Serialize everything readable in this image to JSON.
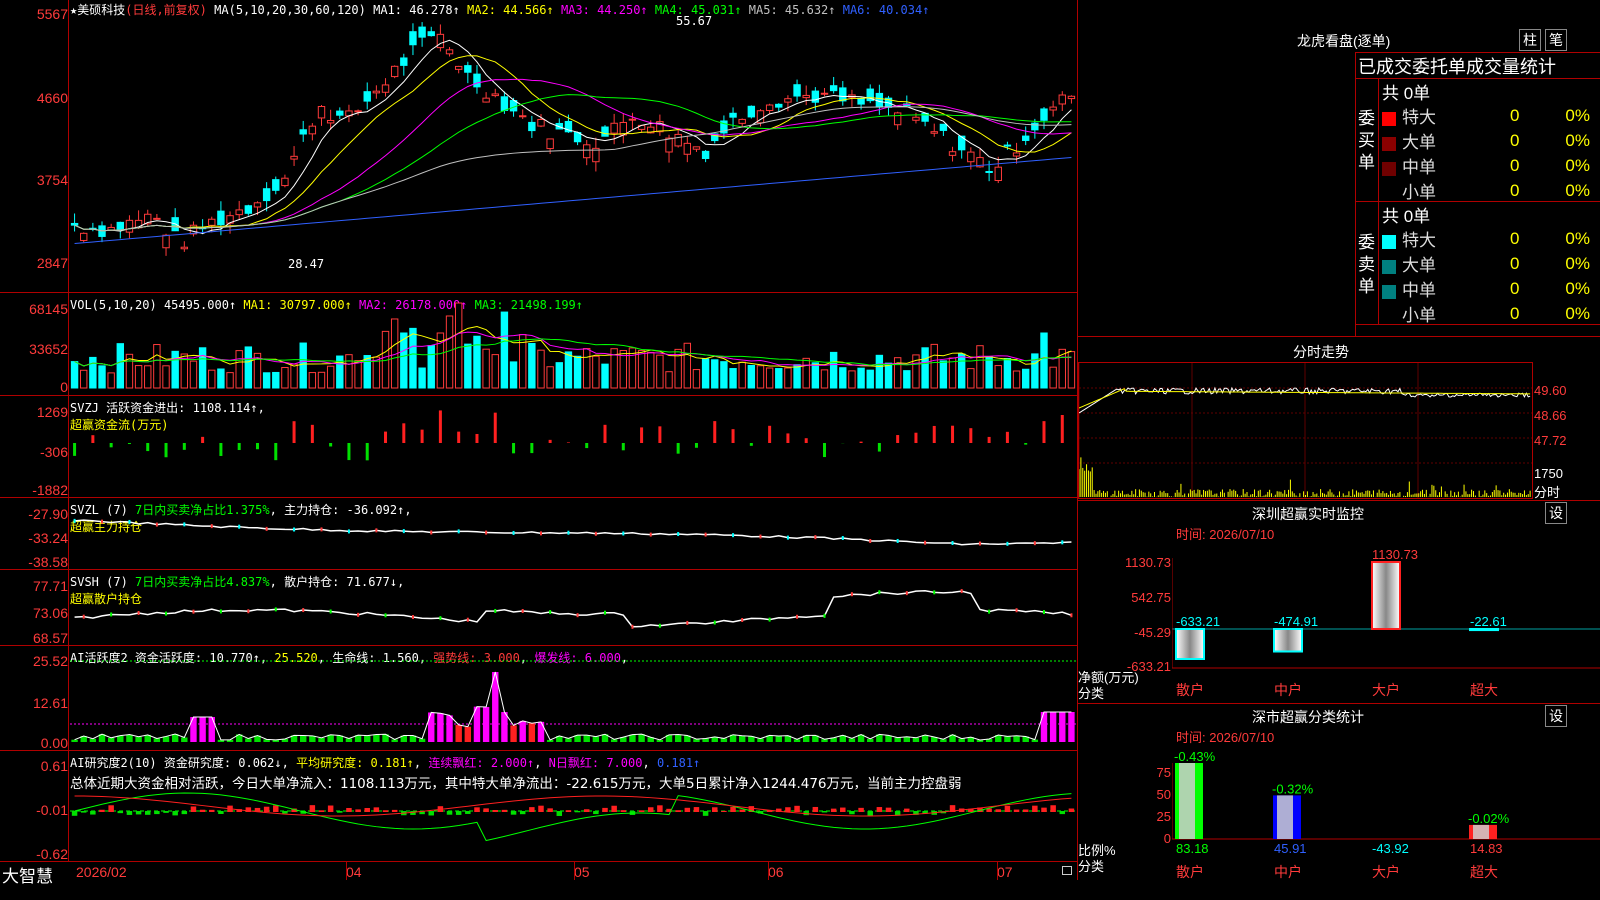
{
  "stock": {
    "name": "★美硕科技",
    "mode": "(日线,前复权)"
  },
  "price_panel": {
    "ma_label": "MA(5,10,20,30,60,120)",
    "ma": [
      {
        "label": "MA1: 46.278↑",
        "color": "#ffffff"
      },
      {
        "label": "MA2: 44.566↑",
        "color": "#ffff00"
      },
      {
        "label": "MA3: 44.250↑",
        "color": "#ff00ff"
      },
      {
        "label": "MA4: 45.031↑",
        "color": "#00ff00"
      },
      {
        "label": "MA5: 45.632↑",
        "color": "#c0c0c0"
      },
      {
        "label": "MA6: 40.034↑",
        "color": "#3060ff"
      }
    ],
    "axis": [
      "5567",
      "4660",
      "3754",
      "2847"
    ],
    "high_label": "55.67",
    "low_label": "28.47"
  },
  "vol_panel": {
    "label": "VOL(5,10,20)",
    "value": "45495.000↑",
    "ma1": "MA1: 30797.000↑",
    "ma2": "MA2: 26178.000↑",
    "ma3": "MA3: 21498.199↑",
    "axis": [
      "68145",
      "33652",
      "0"
    ]
  },
  "svzj_panel": {
    "label": "SVZJ",
    "title": "活跃资金进出: 1108.114↑",
    "sub": "超赢资金流(万元)",
    "axis": [
      "1269",
      "-306",
      "-1882"
    ]
  },
  "svzl_panel": {
    "label": "SVZL (7)",
    "ratio": "7日内买卖净占比1.375%",
    "hold": "主力持仓: -36.092↑",
    "sub": "超赢主力持仓",
    "axis": [
      "-27.90",
      "-33.24",
      "-38.58"
    ]
  },
  "svsh_panel": {
    "label": "SVSH (7)",
    "ratio": "7日内买卖净占比4.837%",
    "hold": "散户持仓: 71.677↓",
    "sub": "超赢散户持仓",
    "axis": [
      "77.71",
      "73.06",
      "68.57"
    ]
  },
  "ai_active": {
    "label": "AI活跃度2",
    "a": "资金活跃度: 10.770↑",
    "b": "25.520",
    "c": "生命线: 1.560",
    "d": "强势线: 3.000",
    "e": "爆发线: 6.000",
    "axis": [
      "25.52",
      "12.61",
      "0.00"
    ]
  },
  "ai_research": {
    "label": "AI研究度2(10)",
    "a": "资金研究度: 0.062↓",
    "b": "平均研究度: 0.181↑",
    "c": "连续飘红: 2.000↑",
    "d": "N日飘红: 7.000",
    "e": "0.181↑",
    "summary": "总体近期大资金相对活跃，今日大单净流入：1108.113万元，其中特大单净流出：-22.615万元，大单5日累计净入1244.476万元，当前主力控盘弱",
    "axis": [
      "0.61",
      "-0.01",
      "-0.62"
    ]
  },
  "date_axis": [
    "2026/02",
    "04",
    "05",
    "06",
    "07"
  ],
  "brand": "大智慧",
  "longhu": {
    "title": "龙虎看盘(逐单)",
    "btn_col": "柱",
    "btn_tick": "笔",
    "tabs": "已成交委托单成交量统计",
    "buy_label": "委买单",
    "sell_label": "委卖单",
    "buy_total": "共 0单",
    "sell_total": "共 0单",
    "buy_rows": [
      {
        "name": "特大",
        "count": "0",
        "pct": "0%",
        "color": "#ff0000"
      },
      {
        "name": "大单",
        "count": "0",
        "pct": "0%",
        "color": "#8b0000"
      },
      {
        "name": "中单",
        "count": "0",
        "pct": "0%",
        "color": "#700000"
      },
      {
        "name": "小单",
        "count": "0",
        "pct": "0%",
        "color": ""
      }
    ],
    "sell_rows": [
      {
        "name": "特大",
        "count": "0",
        "pct": "0%",
        "color": "#00ffff"
      },
      {
        "name": "大单",
        "count": "0",
        "pct": "0%",
        "color": "#008080"
      },
      {
        "name": "中单",
        "count": "0",
        "pct": "0%",
        "color": "#008080"
      },
      {
        "name": "小单",
        "count": "0",
        "pct": "0%",
        "color": ""
      }
    ]
  },
  "intraday": {
    "title": "分时走势",
    "axis": [
      "49.60",
      "48.66",
      "47.72"
    ],
    "vol_axis": [
      "1750",
      "分时"
    ]
  },
  "sz_monitor": {
    "title": "深圳超赢实时监控",
    "btn": "设",
    "time": "时间: 2026/07/10",
    "axis": [
      "1130.73",
      "542.75",
      "-45.29",
      "-633.21"
    ],
    "y_title": "净额(万元)",
    "x_title": "分类",
    "chart_data": {
      "type": "bar",
      "categories": [
        "散户",
        "中户",
        "大户",
        "超大"
      ],
      "values": [
        -633.21,
        -474.91,
        1130.73,
        -22.61
      ],
      "labels": [
        "-633.21",
        "-474.91",
        "1130.73",
        "-22.61"
      ],
      "ylim": [
        -633.21,
        1130.73
      ]
    }
  },
  "sz_class": {
    "title": "深市超赢分类统计",
    "btn": "设",
    "time": "时间: 2026/07/10",
    "axis": [
      "75",
      "50",
      "25",
      "0"
    ],
    "y_title": "比例%",
    "x_title": "分类",
    "chart_data": {
      "type": "bar",
      "categories": [
        "散户",
        "中户",
        "大户",
        "超大"
      ],
      "values": [
        83.18,
        45.91,
        -43.92,
        14.83
      ],
      "value_labels": [
        "83.18",
        "45.91",
        "-43.92",
        "14.83"
      ],
      "top_labels": [
        "-0.43%",
        "-0.32%",
        "",
        "-0.02%"
      ],
      "ylim": [
        0,
        75
      ]
    }
  },
  "chart_data": {
    "type": "candlestick",
    "title": "美硕科技 (日线,前复权)",
    "ylim": [
      28.47,
      55.67
    ],
    "high": 55.67,
    "low": 28.47,
    "x_ticks": [
      "2026/02",
      "04",
      "05",
      "06",
      "07"
    ]
  }
}
